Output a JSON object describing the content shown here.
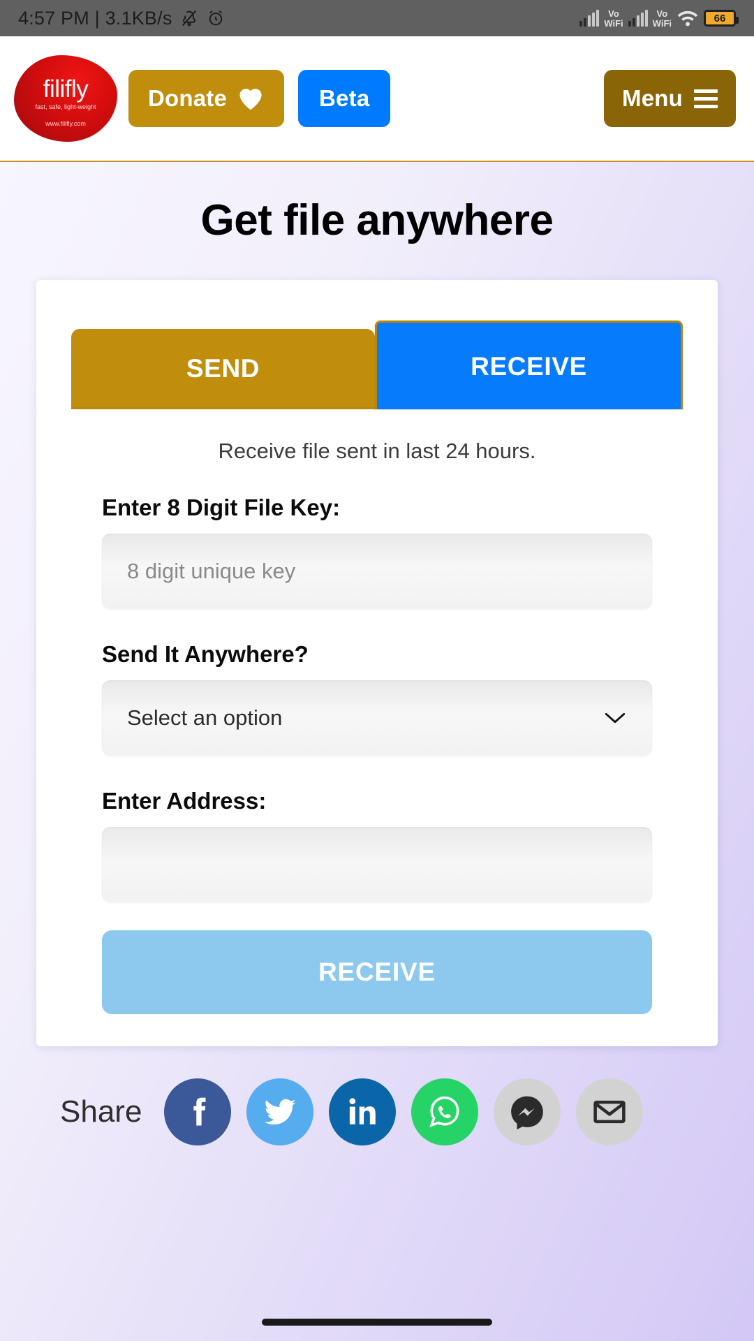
{
  "statusbar": {
    "time_and_speed": "4:57 PM | 3.1KB/s",
    "icons": [
      "bell-off-icon",
      "alarm-clock-icon",
      "signal-bars-icon",
      "volte-wifi-icon",
      "signal-bars-icon-2",
      "volte-wifi-icon-2",
      "wifi-icon",
      "battery-icon"
    ],
    "volte_top": "Vo",
    "volte_bottom": "WiFi",
    "battery_level": "66"
  },
  "header": {
    "logo": {
      "word": "filifly",
      "tagline": "fast, safe, light-weight",
      "url": "www.filifly.com"
    },
    "donate_label": "Donate",
    "donate_icon": "heart-icon",
    "beta_label": "Beta",
    "menu_label": "Menu",
    "menu_icon": "hamburger-icon",
    "colors": {
      "donate_bg": "#c18d0c",
      "beta_bg": "#007bff",
      "menu_bg": "#8a6508",
      "logo_red": "#d40d0d"
    }
  },
  "main": {
    "page_title": "Get file anywhere",
    "tabs": [
      {
        "label": "SEND",
        "active": false
      },
      {
        "label": "RECEIVE",
        "active": true
      }
    ],
    "note": "Receive file sent in last 24 hours.",
    "fields": {
      "file_key": {
        "label": "Enter 8 Digit File Key:",
        "placeholder": "8 digit unique key",
        "value": ""
      },
      "send_anywhere": {
        "label": "Send It Anywhere?",
        "selected": "Select an option",
        "icon": "chevron-down-icon"
      },
      "address": {
        "label": "Enter Address:",
        "placeholder": "",
        "value": ""
      }
    },
    "submit_label": "RECEIVE",
    "colors": {
      "tab_active_bg": "#067bfb",
      "tab_inactive_bg": "#c18d0c",
      "tab_border": "#b8860b",
      "submit_bg": "#8dc8ee"
    }
  },
  "share": {
    "label": "Share",
    "items": [
      {
        "name": "facebook-icon",
        "bg": "#3b5998"
      },
      {
        "name": "twitter-icon",
        "bg": "#55acee"
      },
      {
        "name": "linkedin-icon",
        "bg": "#0a66a8"
      },
      {
        "name": "whatsapp-icon",
        "bg": "#25d366"
      },
      {
        "name": "messenger-icon",
        "bg": "#d2d2d2"
      },
      {
        "name": "email-icon",
        "bg": "#d2d2d2"
      }
    ]
  }
}
